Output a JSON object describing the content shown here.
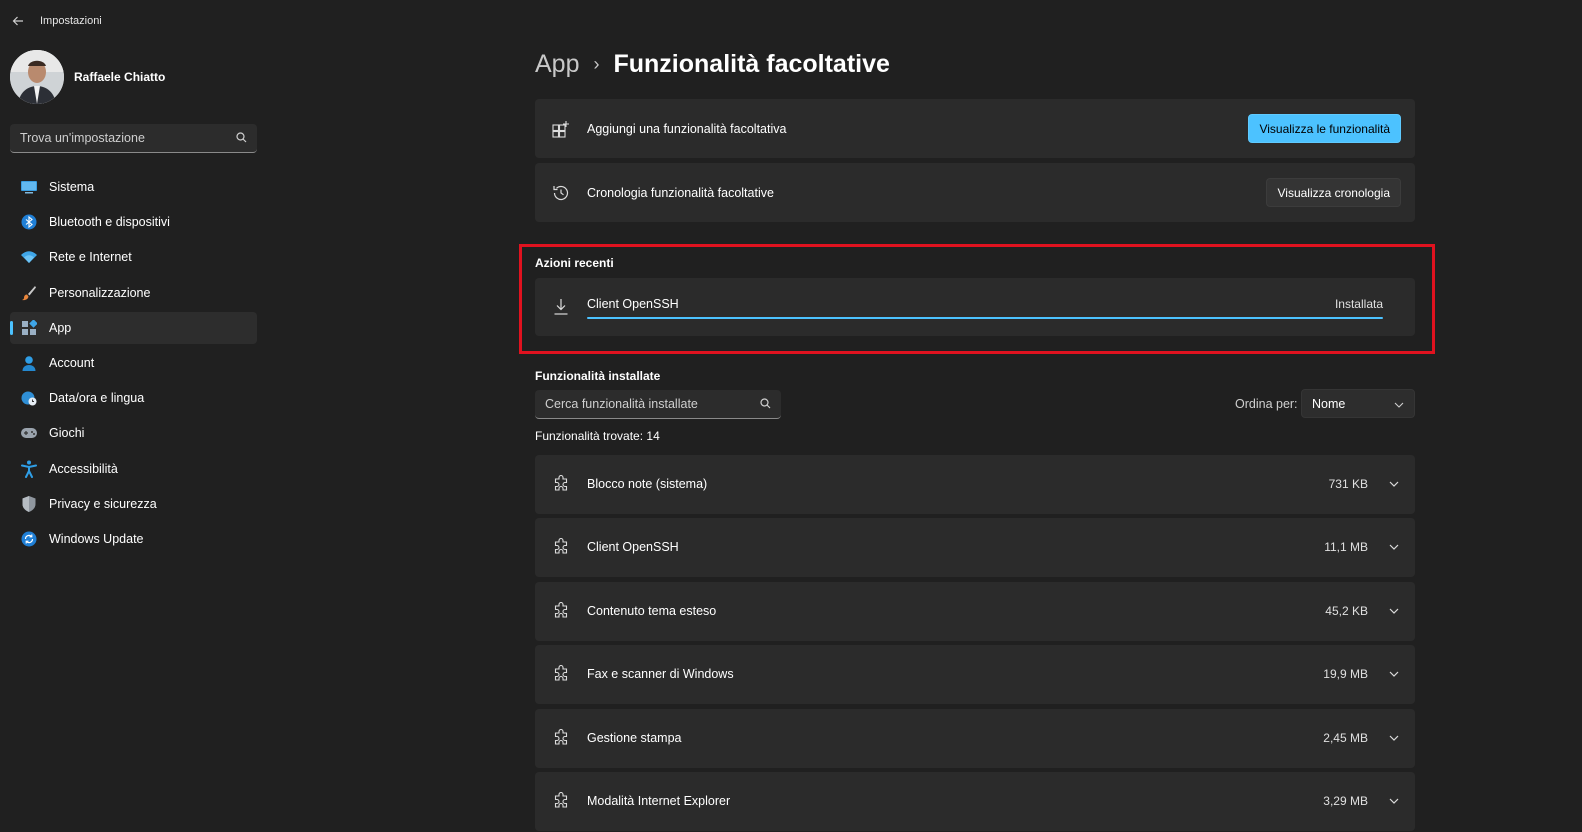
{
  "window": {
    "title": "Impostazioni"
  },
  "user": {
    "name": "Raffaele Chiatto"
  },
  "search": {
    "placeholder": "Trova un'impostazione"
  },
  "sidebar": {
    "items": [
      {
        "label": "Sistema",
        "icon": "monitor-icon"
      },
      {
        "label": "Bluetooth e dispositivi",
        "icon": "bluetooth-icon"
      },
      {
        "label": "Rete e Internet",
        "icon": "wifi-icon"
      },
      {
        "label": "Personalizzazione",
        "icon": "brush-icon"
      },
      {
        "label": "App",
        "icon": "apps-icon",
        "active": true
      },
      {
        "label": "Account",
        "icon": "person-icon"
      },
      {
        "label": "Data/ora e lingua",
        "icon": "globe-clock-icon"
      },
      {
        "label": "Giochi",
        "icon": "gamepad-icon"
      },
      {
        "label": "Accessibilità",
        "icon": "accessibility-icon"
      },
      {
        "label": "Privacy e sicurezza",
        "icon": "shield-icon"
      },
      {
        "label": "Windows Update",
        "icon": "update-icon"
      }
    ]
  },
  "breadcrumb": {
    "parent": "App",
    "separator": "›",
    "current": "Funzionalità facoltative"
  },
  "add_feature": {
    "label": "Aggiungi una funzionalità facoltativa",
    "button": "Visualizza le funzionalità"
  },
  "history": {
    "label": "Cronologia funzionalità facoltative",
    "button": "Visualizza cronologia"
  },
  "recent": {
    "title": "Azioni recenti",
    "item": {
      "name": "Client OpenSSH",
      "status": "Installata",
      "progress": 1.0
    }
  },
  "installed": {
    "title": "Funzionalità installate",
    "search_placeholder": "Cerca funzionalità installate",
    "sort_label": "Ordina per:",
    "sort_value": "Nome",
    "count_text": "Funzionalità trovate: 14",
    "items": [
      {
        "name": "Blocco note (sistema)",
        "size": "731 KB"
      },
      {
        "name": "Client OpenSSH",
        "size": "11,1 MB"
      },
      {
        "name": "Contenuto tema esteso",
        "size": "45,2 KB"
      },
      {
        "name": "Fax e scanner di Windows",
        "size": "19,9 MB"
      },
      {
        "name": "Gestione stampa",
        "size": "2,45 MB"
      },
      {
        "name": "Modalità Internet Explorer",
        "size": "3,29 MB"
      }
    ]
  },
  "colors": {
    "accent": "#4cc2ff",
    "highlight": "#e0121f",
    "background": "#202020",
    "card": "#2b2b2b"
  }
}
